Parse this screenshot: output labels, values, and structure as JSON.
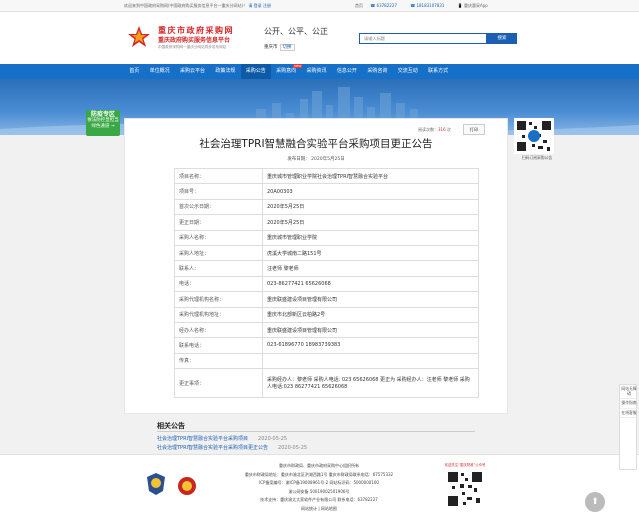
{
  "topbar": {
    "welcome": "欢迎来到中国政府采购网(中国政府购买服务信息平台—重庆分网站)！",
    "login": "请 登录",
    "register": "注册",
    "home": "首页",
    "phone1": "63782227",
    "phone2": "18183107831",
    "app": "重庆惠采App"
  },
  "header": {
    "logo_title": "重庆市政府采购网",
    "logo_subtitle": "重庆政府购买服务信息平台",
    "logo_en": "中国政府采购网一重庆分网站同步发布网站",
    "slogan": "公开、公平、公正",
    "region": "重庆市",
    "region_switch": "切换",
    "search_placeholder": "请输入标题",
    "search_button": "搜索"
  },
  "nav": {
    "items": [
      {
        "label": "首页"
      },
      {
        "label": "单位概况"
      },
      {
        "label": "采购云平台"
      },
      {
        "label": "政策法规"
      },
      {
        "label": "采购公告",
        "active": true
      },
      {
        "label": "采购意向",
        "badge": "NEW"
      },
      {
        "label": "采购资讯"
      },
      {
        "label": "信息公开"
      },
      {
        "label": "采购咨询"
      },
      {
        "label": "交流互动"
      },
      {
        "label": "联系方式"
      }
    ]
  },
  "special": {
    "title": "防疫专区",
    "line1": "依法防控显担当",
    "line2": "绿色通道 →"
  },
  "article": {
    "read_label": "阅读次数：",
    "read_count": "316",
    "unit": "次",
    "print": "打印",
    "title": "社会治理TPRI智慧融合实验平台采购项目更正公告",
    "pubdate": "发布日期： 2020年5月25日",
    "rows": [
      {
        "k": "项目名称：",
        "v": "重庆城市管理职业学院社会治理TPRI智慧融合实验平台"
      },
      {
        "k": "项目号：",
        "v": "20A00303"
      },
      {
        "k": "首次公示日期：",
        "v": "2020年5月25日"
      },
      {
        "k": "更正日期：",
        "v": "2020年5月25日"
      },
      {
        "k": "采购人名称：",
        "v": "重庆城市管理职业学院"
      },
      {
        "k": "采购人地址：",
        "v": "虎溪大学城南二路151号"
      },
      {
        "k": "联系人：",
        "v": "汪老师 黎老师"
      },
      {
        "k": "电话：",
        "v": "023-86277421 65626068"
      },
      {
        "k": "采购代理机构名称：",
        "v": "重庆联盛建设项目管理有限公司"
      },
      {
        "k": "采购代理机构地址：",
        "v": "重庆市北部新区云柏路2号"
      },
      {
        "k": "经办人名称：",
        "v": "重庆联盛建设项目管理有限公司"
      },
      {
        "k": "联系电话：",
        "v": "023-61896770 18983739383"
      },
      {
        "k": "传真：",
        "v": ""
      },
      {
        "k": "更正事项：",
        "v": "采购经办人：黎老师 采购人电话: 023 65626068 更正为 采购经办人：汪老师 黎老师 采购人电话:023 86277421 65626068"
      }
    ]
  },
  "side_qr": {
    "caption": "扫码订阅采购公告"
  },
  "related": {
    "title": "相关公告",
    "items": [
      {
        "title": "社会治理TPRI智慧融合实验平台采购项目",
        "date": "2020-05-25"
      },
      {
        "title": "社会治理TPRI智慧融合实验平台采购项目更正公告",
        "date": "2020-05-25"
      }
    ]
  },
  "footer": {
    "lines": [
      "重庆市财政局、重庆市政府采购中心组织所有",
      "重庆市财政局地址：重庆市渝北区洪湖西路1号 重庆市财政局联系电话：67575332",
      "ICP备案编号：渝ICP备19008961号-2 网站标识码：5000000100",
      "渝公网安备 50019002501906号",
      "技术支持：重庆渝太大家软件产业有限公司 联系电话：63782227",
      "网站统计 | 网站地图"
    ],
    "qr_caption": "欢迎关注“重庆财政”公众号"
  },
  "right_tools": [
    "网站无障碍",
    "操作指南",
    "在线客服"
  ],
  "colors": {
    "brand_blue": "#1770c8",
    "brand_red": "#d6282a",
    "special_green": "#39a845"
  }
}
